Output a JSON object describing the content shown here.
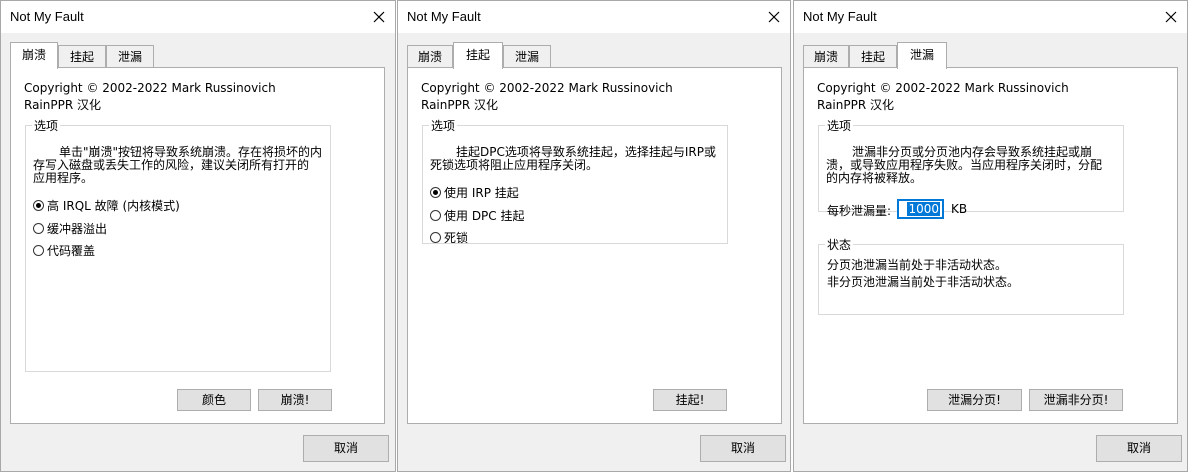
{
  "windows": [
    {
      "title": "Not My Fault",
      "tabs": [
        "崩溃",
        "挂起",
        "泄漏"
      ],
      "copyright": "Copyright © 2002-2022 Mark Russinovich",
      "localizer": "RainPPR 汉化",
      "options_legend": "选项",
      "description_line1": "单击\"崩溃\"按钮将导致系统崩溃。存在将损坏的内",
      "description_line2": "存写入磁盘或丢失工作的风险，建议关闭所有打开的",
      "description_line3": "应用程序。",
      "radios": [
        "高 IRQL 故障 (内核模式)",
        "缓冲器溢出",
        "代码覆盖"
      ],
      "color_button": "颜色",
      "crash_button": "崩溃!",
      "cancel_button": "取消"
    },
    {
      "title": "Not My Fault",
      "tabs": [
        "崩溃",
        "挂起",
        "泄漏"
      ],
      "copyright": "Copyright © 2002-2022 Mark Russinovich",
      "localizer": "RainPPR 汉化",
      "options_legend": "选项",
      "description_line1": "挂起DPC选项将导致系统挂起，选择挂起与IRP或",
      "description_line2": "死锁选项将阻止应用程序关闭。",
      "radios": [
        "使用 IRP 挂起",
        "使用 DPC 挂起",
        "死锁"
      ],
      "hang_button": "挂起!",
      "cancel_button": "取消"
    },
    {
      "title": "Not My Fault",
      "tabs": [
        "崩溃",
        "挂起",
        "泄漏"
      ],
      "copyright": "Copyright © 2002-2022 Mark Russinovich",
      "localizer": "RainPPR 汉化",
      "options_legend": "选项",
      "description_line1": "泄漏非分页或分页池内存会导致系统挂起或崩",
      "description_line2": "溃，或导致应用程序失败。当应用程序关闭时，分配",
      "description_line3": "的内存将被释放。",
      "leak_label": "每秒泄漏量:",
      "leak_value": "1000",
      "leak_unit": "KB",
      "status_legend": "状态",
      "status_paged": "分页池泄漏当前处于非活动状态。",
      "status_nonpaged": "非分页池泄漏当前处于非活动状态。",
      "leak_paged_button": "泄漏分页!",
      "leak_nonpaged_button": "泄漏非分页!",
      "cancel_button": "取消"
    }
  ],
  "colors": {
    "selection_blue": "#0078d7",
    "dialog_bg": "#f0f0f0"
  }
}
